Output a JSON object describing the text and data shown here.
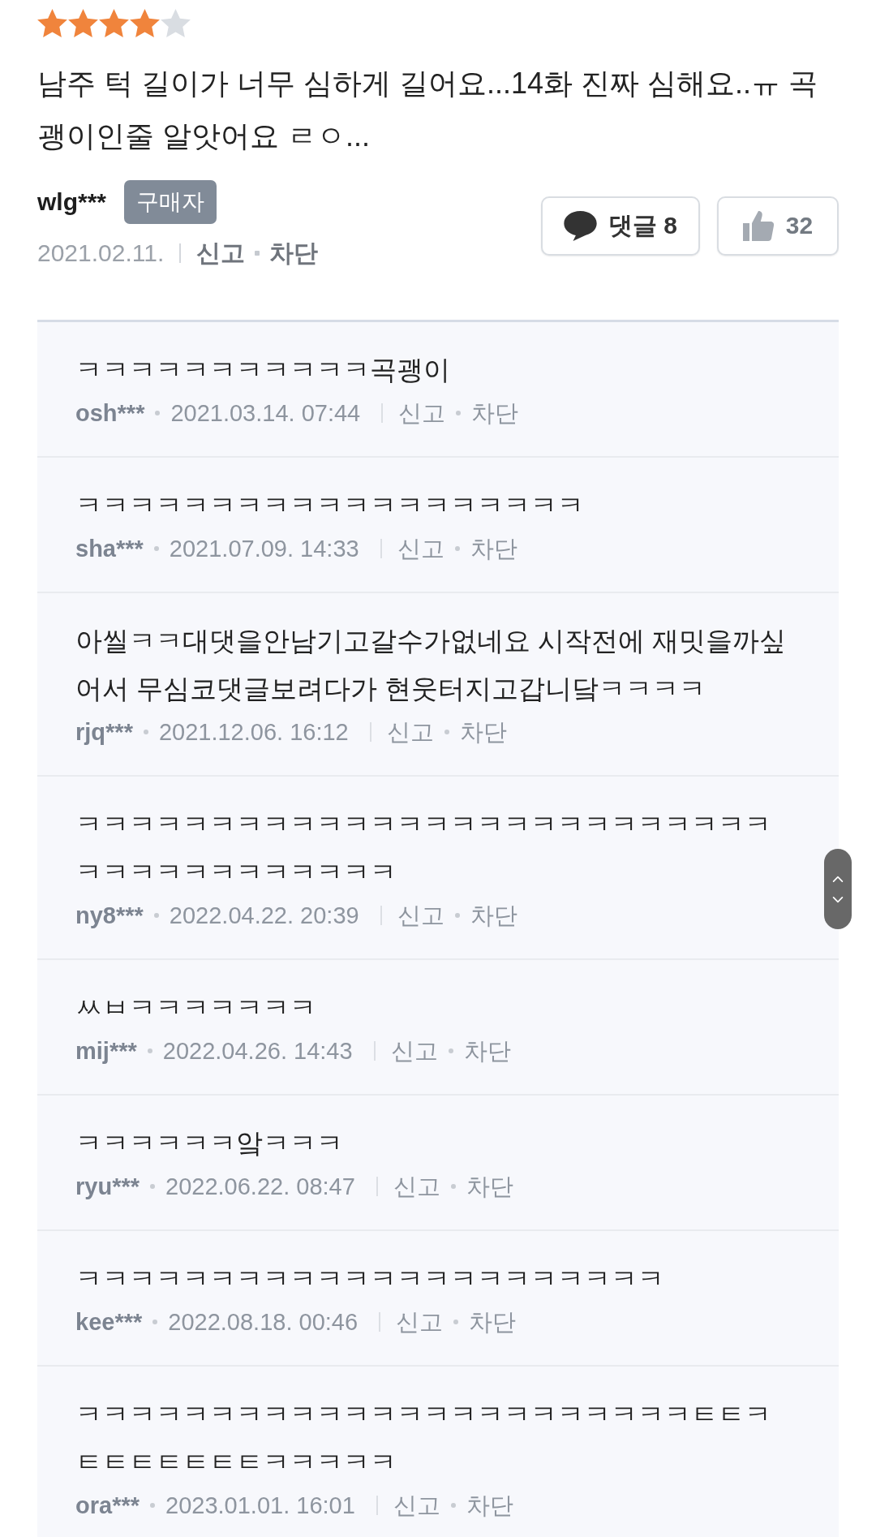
{
  "review": {
    "stars": 4,
    "text": "남주 턱 길이가 너무 심하게 길어요...14화 진짜 심해요..ㅠ 곡괭이인줄 알앗어요 ㄹㅇ...",
    "author": "wlg***",
    "badge": "구매자",
    "date": "2021.02.11.",
    "actions": [
      "신고",
      "차단"
    ],
    "comment_button": "댓글 8",
    "like_count": "32"
  },
  "comments": [
    {
      "text": "ㅋㅋㅋㅋㅋㅋㅋㅋㅋㅋㅋ곡괭이",
      "author": "osh***",
      "datetime": "2021.03.14. 07:44",
      "actions": [
        "신고",
        "차단"
      ]
    },
    {
      "text": "ㅋㅋㅋㅋㅋㅋㅋㅋㅋㅋㅋㅋㅋㅋㅋㅋㅋㅋㅋ",
      "author": "sha***",
      "datetime": "2021.07.09. 14:33",
      "actions": [
        "신고",
        "차단"
      ]
    },
    {
      "text": "아씰ㅋㅋ대댓을안남기고갈수가없네요 시작전에 재밋을까싶어서 무심코댓글보려다가 현웃터지고갑니닼ㅋㅋㅋㅋ",
      "author": "rjq***",
      "datetime": "2021.12.06. 16:12",
      "actions": [
        "신고",
        "차단"
      ]
    },
    {
      "text": "ㅋㅋㅋㅋㅋㅋㅋㅋㅋㅋㅋㅋㅋㅋㅋㅋㅋㅋㅋㅋㅋㅋㅋㅋㅋㅋㅋㅋㅋㅋㅋㅋㅋㅋㅋㅋㅋㅋ",
      "author": "ny8***",
      "datetime": "2022.04.22. 20:39",
      "actions": [
        "신고",
        "차단"
      ]
    },
    {
      "text": "ㅆㅂㅋㅋㅋㅋㅋㅋㅋ",
      "author": "mij***",
      "datetime": "2022.04.26. 14:43",
      "actions": [
        "신고",
        "차단"
      ]
    },
    {
      "text": "ㅋㅋㅋㅋㅋㅋ앜ㅋㅋㅋ",
      "author": "ryu***",
      "datetime": "2022.06.22. 08:47",
      "actions": [
        "신고",
        "차단"
      ]
    },
    {
      "text": "ㅋㅋㅋㅋㅋㅋㅋㅋㅋㅋㅋㅋㅋㅋㅋㅋㅋㅋㅋㅋㅋㅋ",
      "author": "kee***",
      "datetime": "2022.08.18. 00:46",
      "actions": [
        "신고",
        "차단"
      ]
    },
    {
      "text": "ㅋㅋㅋㅋㅋㅋㅋㅋㅋㅋㅋㅋㅋㅋㅋㅋㅋㅋㅋㅋㅋㅋㅋㅌㅌㅋㅌㅌㅌㅌㅌㅌㅌㅋㅋㅋㅋㅋ",
      "author": "ora***",
      "datetime": "2023.01.01. 16:01",
      "actions": [
        "신고",
        "차단"
      ]
    }
  ]
}
